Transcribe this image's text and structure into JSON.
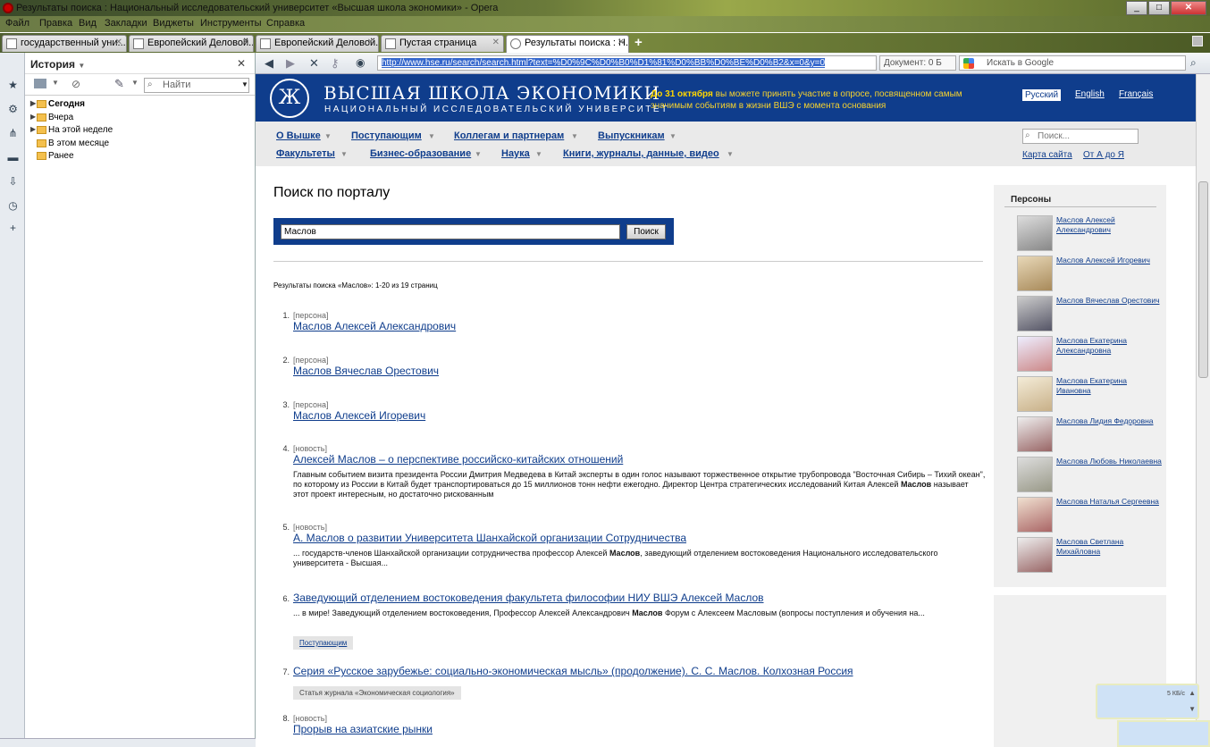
{
  "window": {
    "title": "Результаты поиска : Национальный исследовательский университет «Высшая школа экономики» - Opera",
    "controls": [
      "_",
      "□",
      "✕"
    ]
  },
  "menu": [
    "Файл",
    "Правка",
    "Вид",
    "Закладки",
    "Виджеты",
    "Инструменты",
    "Справка"
  ],
  "tabs": [
    {
      "label": "государственный уни..."
    },
    {
      "label": "Европейский Деловой..."
    },
    {
      "label": "Европейский Деловой..."
    },
    {
      "label": "Пустая страница"
    },
    {
      "label": "Результаты поиска : Н..."
    }
  ],
  "history_panel": {
    "title": "История",
    "find_placeholder": "Найти",
    "items": [
      {
        "label": "Сегодня",
        "bold": true
      },
      {
        "label": "Вчера"
      },
      {
        "label": "На этой неделе"
      },
      {
        "label": "В этом месяце"
      },
      {
        "label": "Ранее"
      }
    ]
  },
  "address_bar": {
    "url": "http://www.hse.ru/search/search.html?text=%D0%9C%D0%B0%D1%81%D0%BB%D0%BE%D0%B2&x=0&y=0",
    "document_size": "Документ:   0 Б",
    "search_placeholder": "Искать в Google"
  },
  "site": {
    "logo_line1": "ВЫСШАЯ ШКОЛА ЭКОНОМИКИ",
    "logo_line2": "НАЦИОНАЛЬНЫЙ ИССЛЕДОВАТЕЛЬСКИЙ УНИВЕРСИТЕТ",
    "announcement_bold": "До 31 октября",
    "announcement_text": " вы можете принять участие в опросе, посвященном самым значимым событиям в жизни ВШЭ с момента основания",
    "languages": [
      "Русский",
      "English",
      "Français"
    ],
    "nav_row1": [
      "О Вышке",
      "Поступающим",
      "Коллегам и партнерам",
      "Выпускникам"
    ],
    "nav_row2": [
      "Факультеты",
      "Бизнес-образование",
      "Наука",
      "Книги, журналы, данные, видео"
    ],
    "search_placeholder": "Поиск...",
    "sitemap": "Карта сайта",
    "az": "От А до Я"
  },
  "search": {
    "heading": "Поиск по порталу",
    "query": "Маслов",
    "button": "Поиск",
    "summary": "Результаты поиска «Маслов»: 1-20 из 19 страниц"
  },
  "results": [
    {
      "num": "1.",
      "cat": "[персона]",
      "title": "Маслов Алексей Александрович"
    },
    {
      "num": "2.",
      "cat": "[персона]",
      "title": "Маслов Вячеслав Орестович"
    },
    {
      "num": "3.",
      "cat": "[персона]",
      "title": "Маслов Алексей Игоревич"
    },
    {
      "num": "4.",
      "cat": "[новость]",
      "title": "Алексей Маслов – о перспективе российско-китайских отношений",
      "snippet_a": "Главным событием визита президента России Дмитрия Медведева в Китай эксперты в один голос называют торжественное открытие трубопровода \"Восточная Сибирь – Тихий океан\", по которому из России в Китай будет транспортироваться до 15 миллионов тонн нефти ежегодно. Директор Центра стратегических исследований Китая Алексей ",
      "snippet_b": "Маслов",
      "snippet_c": " называет этот проект интересным, но достаточно рискованным"
    },
    {
      "num": "5.",
      "cat": "[новость]",
      "title": "А. Маслов о развитии Университета Шанхайской организации Сотрудничества",
      "snippet_a": "... государств-членов Шанхайской организации сотрудничества профессор Алексей ",
      "snippet_b": "Маслов",
      "snippet_c": ", заведующий отделением востоковедения Национального исследовательского университета - Высшая..."
    },
    {
      "num": "6.",
      "title": "Заведующий отделением востоковедения факультета философии НИУ ВШЭ Алексей Маслов",
      "snippet_a": "...  в мире! Заведующий отделением востоковедения, Профессор Алексей Александрович ",
      "snippet_b": "Маслов",
      "snippet_c": " Форум с Алексеем Масловым (вопросы поступления и обучения на...",
      "tag": "Поступающим"
    },
    {
      "num": "7.",
      "title": "Серия «Русское зарубежье: социально-экономическая мысль» (продолжение). С. С. Маслов. Колхозная Россия",
      "tag": "Статья журнала «Экономическая социология»"
    },
    {
      "num": "8.",
      "cat": "[новость]",
      "title": "Прорыв на азиатские рынки"
    }
  ],
  "persons": {
    "heading": "Персоны",
    "items": [
      {
        "name": "Маслов Алексей Александрович"
      },
      {
        "name": "Маслов Алексей Игоревич"
      },
      {
        "name": "Маслов Вячеслав Орестович"
      },
      {
        "name": "Маслова Екатерина Александровна"
      },
      {
        "name": "Маслова Екатерина Ивановна"
      },
      {
        "name": "Маслова Лидия Федоровна"
      },
      {
        "name": "Маслова Любовь Николаевна"
      },
      {
        "name": "Маслова Наталья Сергеевна"
      },
      {
        "name": "Маслова Светлана Михайловна"
      }
    ]
  },
  "popup": {
    "text": "5 КБ/с"
  }
}
